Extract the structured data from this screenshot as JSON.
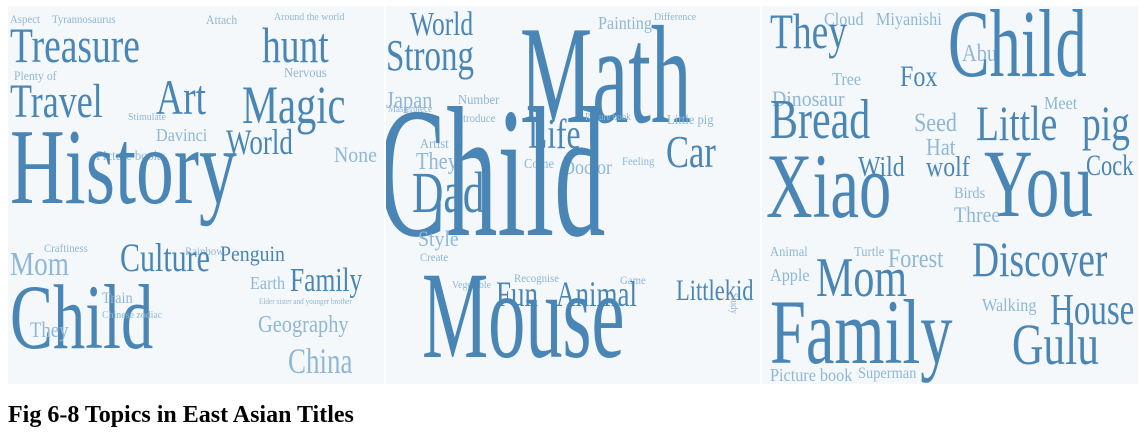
{
  "caption": "Fig 6-8 Topics in East Asian Titles",
  "colors": {
    "strong": "#4a86b5",
    "light": "#8fb7d6",
    "panel": "#f5f8fb"
  },
  "clouds": [
    {
      "words": [
        {
          "text": "Aspect",
          "tone": "light"
        },
        {
          "text": "Tyrannosaurus",
          "tone": "light"
        },
        {
          "text": "Attach",
          "tone": "light"
        },
        {
          "text": "Around the world",
          "tone": "light"
        },
        {
          "text": "Treasure",
          "tone": "strong"
        },
        {
          "text": "hunt",
          "tone": "strong"
        },
        {
          "text": "Plenty of",
          "tone": "light"
        },
        {
          "text": "Nervous",
          "tone": "light"
        },
        {
          "text": "Travel",
          "tone": "strong"
        },
        {
          "text": "Art",
          "tone": "strong"
        },
        {
          "text": "Magic",
          "tone": "strong"
        },
        {
          "text": "Stimulate",
          "tone": "light"
        },
        {
          "text": "Davinci",
          "tone": "light"
        },
        {
          "text": "World",
          "tone": "strong"
        },
        {
          "text": "None",
          "tone": "light"
        },
        {
          "text": "Picture book",
          "tone": "light"
        },
        {
          "text": "History",
          "tone": "strong"
        },
        {
          "text": "Craftiness",
          "tone": "light"
        },
        {
          "text": "Rainbow",
          "tone": "light"
        },
        {
          "text": "Mom",
          "tone": "light"
        },
        {
          "text": "Culture",
          "tone": "strong"
        },
        {
          "text": "Penguin",
          "tone": "strong"
        },
        {
          "text": "Earth",
          "tone": "light"
        },
        {
          "text": "Family",
          "tone": "strong"
        },
        {
          "text": "Child",
          "tone": "strong"
        },
        {
          "text": "Train",
          "tone": "light"
        },
        {
          "text": "Elder sister and younger brother",
          "tone": "light"
        },
        {
          "text": "Chinese zodiac",
          "tone": "light"
        },
        {
          "text": "Geography",
          "tone": "light"
        },
        {
          "text": "They",
          "tone": "light"
        },
        {
          "text": "China",
          "tone": "light"
        }
      ]
    },
    {
      "words": [
        {
          "text": "World",
          "tone": "strong"
        },
        {
          "text": "Painting",
          "tone": "light"
        },
        {
          "text": "Difference",
          "tone": "light"
        },
        {
          "text": "Strong",
          "tone": "strong"
        },
        {
          "text": "Math",
          "tone": "strong"
        },
        {
          "text": "Masterpiece",
          "tone": "light"
        },
        {
          "text": "Japan",
          "tone": "light"
        },
        {
          "text": "Number",
          "tone": "light"
        },
        {
          "text": "Introduce",
          "tone": "light"
        },
        {
          "text": "Picture book",
          "tone": "light"
        },
        {
          "text": "Little pig",
          "tone": "light"
        },
        {
          "text": "Life",
          "tone": "strong"
        },
        {
          "text": "Artist",
          "tone": "light"
        },
        {
          "text": "They",
          "tone": "light"
        },
        {
          "text": "Come",
          "tone": "light"
        },
        {
          "text": "Doctor",
          "tone": "light"
        },
        {
          "text": "Feeling",
          "tone": "light"
        },
        {
          "text": "Car",
          "tone": "strong"
        },
        {
          "text": "Child",
          "tone": "strong"
        },
        {
          "text": "Dad",
          "tone": "strong"
        },
        {
          "text": "Style",
          "tone": "light"
        },
        {
          "text": "Create",
          "tone": "light"
        },
        {
          "text": "Recognise",
          "tone": "light"
        },
        {
          "text": "Game",
          "tone": "light"
        },
        {
          "text": "Fun",
          "tone": "strong"
        },
        {
          "text": "Animal",
          "tone": "strong"
        },
        {
          "text": "Littlekid",
          "tone": "strong"
        },
        {
          "text": "Vegetable",
          "tone": "light"
        },
        {
          "text": "Study",
          "tone": "light"
        },
        {
          "text": "Mouse",
          "tone": "strong"
        }
      ]
    },
    {
      "words": [
        {
          "text": "They",
          "tone": "strong"
        },
        {
          "text": "Cloud",
          "tone": "light"
        },
        {
          "text": "Miyanishi",
          "tone": "light"
        },
        {
          "text": "Abu",
          "tone": "light"
        },
        {
          "text": "Child",
          "tone": "strong"
        },
        {
          "text": "Tree",
          "tone": "light"
        },
        {
          "text": "Fox",
          "tone": "strong"
        },
        {
          "text": "Dinosaur",
          "tone": "light"
        },
        {
          "text": "Meet",
          "tone": "light"
        },
        {
          "text": "Bread",
          "tone": "strong"
        },
        {
          "text": "Seed",
          "tone": "light"
        },
        {
          "text": "Little",
          "tone": "strong"
        },
        {
          "text": "pig",
          "tone": "strong"
        },
        {
          "text": "Hat",
          "tone": "light"
        },
        {
          "text": "Wild",
          "tone": "strong"
        },
        {
          "text": "wolf",
          "tone": "strong"
        },
        {
          "text": "Cock",
          "tone": "strong"
        },
        {
          "text": "Birds",
          "tone": "light"
        },
        {
          "text": "Xiao",
          "tone": "strong"
        },
        {
          "text": "Three",
          "tone": "light"
        },
        {
          "text": "You",
          "tone": "strong"
        },
        {
          "text": "Animal",
          "tone": "light"
        },
        {
          "text": "Turtle",
          "tone": "light"
        },
        {
          "text": "Forest",
          "tone": "light"
        },
        {
          "text": "Apple",
          "tone": "light"
        },
        {
          "text": "Mom",
          "tone": "strong"
        },
        {
          "text": "Discover",
          "tone": "strong"
        },
        {
          "text": "Walking",
          "tone": "light"
        },
        {
          "text": "House",
          "tone": "strong"
        },
        {
          "text": "Family",
          "tone": "strong"
        },
        {
          "text": "Gulu",
          "tone": "strong"
        },
        {
          "text": "Picture book",
          "tone": "light"
        },
        {
          "text": "Superman",
          "tone": "light"
        }
      ]
    }
  ]
}
